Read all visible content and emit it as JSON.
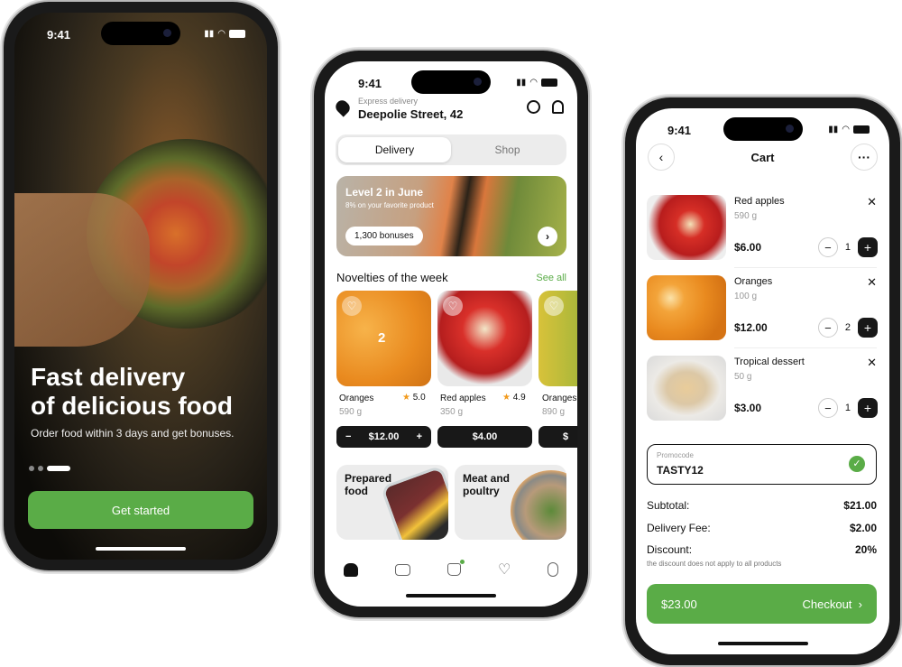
{
  "status": {
    "time": "9:41"
  },
  "onboarding": {
    "headline_line1": "Fast delivery",
    "headline_line2": "of delicious food",
    "subtitle": "Order food within 3 days and get bonuses.",
    "page_indicator": {
      "pages": 3,
      "active": 3
    },
    "cta": "Get started",
    "accent": "#5aac47"
  },
  "home": {
    "delivery_type": "Express delivery",
    "address": "Deepolie Street, 42",
    "tabs": [
      {
        "label": "Delivery",
        "active": true
      },
      {
        "label": "Shop",
        "active": false
      }
    ],
    "banner": {
      "title": "Level 2 in June",
      "subtitle": "8% on your favorite product",
      "bonuses": "1,300 bonuses"
    },
    "section_title": "Novelties of the week",
    "see_all": "See all",
    "products": [
      {
        "name": "Oranges",
        "rating": "5.0",
        "weight": "590 g",
        "price": "$12.00",
        "in_cart": "2",
        "minus": "−",
        "plus": "+"
      },
      {
        "name": "Red apples",
        "rating": "4.9",
        "weight": "350 g",
        "price": "$4.00"
      },
      {
        "name": "Oranges",
        "weight": "890 g",
        "price": "$"
      }
    ],
    "categories": [
      {
        "label": "Prepared food"
      },
      {
        "label": "Meat and poultry"
      }
    ],
    "nav": [
      "home",
      "wallet",
      "basket",
      "favorites",
      "profile"
    ]
  },
  "cart": {
    "title": "Cart",
    "items": [
      {
        "name": "Red apples",
        "weight": "590 g",
        "price": "$6.00",
        "qty": "1"
      },
      {
        "name": "Oranges",
        "weight": "100 g",
        "price": "$12.00",
        "qty": "2"
      },
      {
        "name": "Tropical dessert",
        "weight": "50 g",
        "price": "$3.00",
        "qty": "1"
      }
    ],
    "promo_label": "Promocode",
    "promo_value": "TASTY12",
    "subtotal_label": "Subtotal:",
    "subtotal": "$21.00",
    "fee_label": "Delivery Fee:",
    "fee": "$2.00",
    "discount_label": "Discount:",
    "discount": "20%",
    "discount_note": "the discount does not apply to all products",
    "total": "$23.00",
    "checkout": "Checkout"
  }
}
